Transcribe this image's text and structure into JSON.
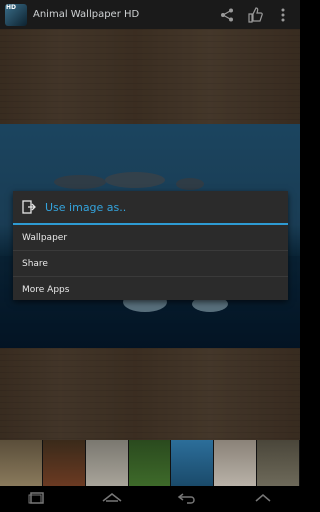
{
  "app": {
    "title": "Animal Wallpaper HD",
    "icon_badge": "HD"
  },
  "actionbar": {
    "icons": [
      "share-icon",
      "thumbs-up-icon",
      "overflow-menu-icon"
    ]
  },
  "dialog": {
    "title": "Use image as..",
    "items": [
      {
        "label": "Wallpaper"
      },
      {
        "label": "Share"
      },
      {
        "label": "More Apps"
      }
    ]
  },
  "thumbnails": [
    {
      "name": "thumb-bunnies",
      "color": "#8a7a5c"
    },
    {
      "name": "thumb-red-panda",
      "color": "#6b3a22"
    },
    {
      "name": "thumb-kittens",
      "color": "#a8a49a"
    },
    {
      "name": "thumb-panda",
      "color": "#3e6a2a"
    },
    {
      "name": "thumb-dolphins",
      "color": "#2c6e9a"
    },
    {
      "name": "thumb-cat",
      "color": "#b9b2a8"
    },
    {
      "name": "thumb-rabbit",
      "color": "#6e6a5a"
    }
  ],
  "navbar": {
    "icons": [
      "recent-apps-icon",
      "home-icon",
      "back-icon",
      "chevron-up-icon"
    ]
  },
  "colors": {
    "accent": "#34a4dd",
    "dialog_bg": "#2b2b2b",
    "actionbar_bg": "#1a1a1a"
  }
}
